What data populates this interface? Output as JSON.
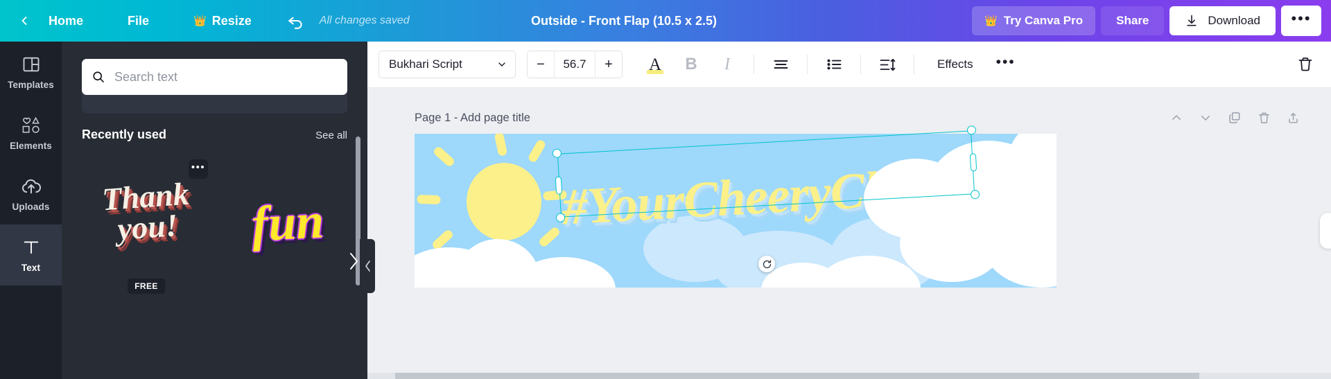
{
  "topbar": {
    "back_icon": "chevron-left-icon",
    "home_label": "Home",
    "file_label": "File",
    "resize_label": "Resize",
    "resize_icon": "crown-icon",
    "undo_icon": "undo-arrow-icon",
    "save_status": "All changes saved",
    "design_title": "Outside - Front Flap (10.5 x 2.5)",
    "pro_label": "Try Canva Pro",
    "pro_icon": "crown-icon",
    "share_label": "Share",
    "download_label": "Download",
    "download_icon": "download-arrow-icon",
    "more_label": "•••",
    "gradient_start": "#00c4cc",
    "gradient_end": "#8b3dee"
  },
  "rail": {
    "items": [
      {
        "label": "Templates",
        "icon": "templates-grid-icon",
        "active": false
      },
      {
        "label": "Elements",
        "icon": "elements-shapes-icon",
        "active": false
      },
      {
        "label": "Uploads",
        "icon": "upload-cloud-icon",
        "active": false
      },
      {
        "label": "Text",
        "icon": "text-t-icon",
        "active": true
      }
    ]
  },
  "panel": {
    "search_placeholder": "Search text",
    "search_value": "",
    "search_icon": "search-icon",
    "section_title": "Recently used",
    "see_all_label": "See all",
    "next_icon": "chevron-right-icon",
    "collapse_icon": "chevron-left-icon",
    "thumbs": [
      {
        "name": "thank-you-text-style",
        "line1": "Thank",
        "line2": "you!",
        "badge": "FREE",
        "menu": "•••"
      },
      {
        "name": "fun-text-style",
        "line1": "fun",
        "badge": "",
        "menu": ""
      }
    ]
  },
  "toolbar": {
    "font_family": "Bukhari Script",
    "font_dropdown_icon": "chevron-down-icon",
    "size_minus": "−",
    "font_size": "56.7",
    "size_plus": "+",
    "text_color_glyph": "A",
    "text_color_swatch": "#f5ee7e",
    "bold_glyph": "B",
    "italic_glyph": "I",
    "align_icon": "align-left-icon",
    "list_icon": "bullet-list-icon",
    "spacing_icon": "line-spacing-icon",
    "effects_label": "Effects",
    "more_label": "•••",
    "delete_icon": "trash-icon"
  },
  "canvas": {
    "page_title": "Page 1 - Add page title",
    "page_tools": [
      {
        "name": "move-up-icon",
        "glyph": "⌃"
      },
      {
        "name": "move-down-icon",
        "glyph": "⌄"
      },
      {
        "name": "duplicate-page-icon",
        "glyph": "⧉"
      },
      {
        "name": "delete-page-icon",
        "glyph": "🗑"
      },
      {
        "name": "add-page-icon",
        "glyph": "⎋"
      }
    ],
    "artwork": {
      "background_color": "#9ed8fb",
      "sun_color": "#fbf08a",
      "cloud_color": "#ffffff",
      "selected_text": "#YourCheeryCloud",
      "selected_text_color": "#fbf08a",
      "selection_color": "#00c4cc",
      "rotate_icon": "rotate-icon"
    }
  }
}
